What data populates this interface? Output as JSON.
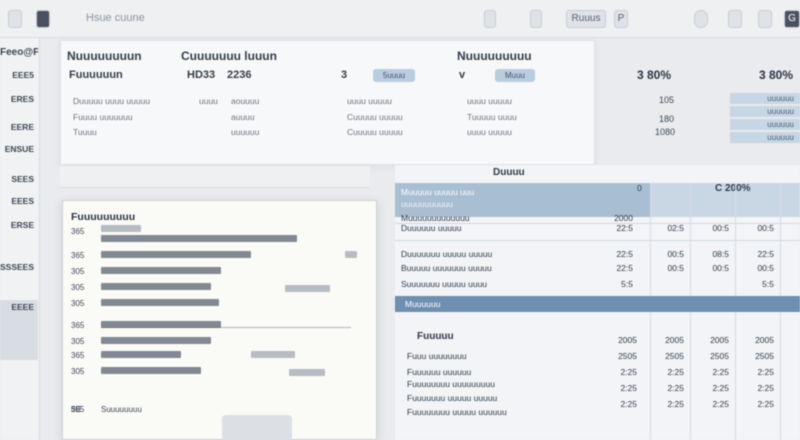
{
  "toolbar": {
    "search_placeholder": "Hsue cuune",
    "btn_a": "Ruuus",
    "btn_b": "P",
    "label_right": "G"
  },
  "sidebar": {
    "title": "Feeo@P",
    "items": [
      "EEE5",
      "ERES",
      "EERE",
      "ENSUE",
      "SEES",
      "EEES",
      "ERSE",
      "SSSEES",
      "EEEE"
    ]
  },
  "top_panel": {
    "col1_head": "Nuuuuuuuun",
    "col2_head": "Cuuuuuuu luuun",
    "col3_head": "Nuuuuuuuuu",
    "row_label": "Fuuuuuun",
    "row_val_a": "HD33",
    "row_val_b": "2236",
    "row_val_c": "3",
    "pill_a": "5uuuu",
    "pill_b": "Muuu",
    "sub_rows": [
      {
        "a": "Duuuuu uuuu uuuuu",
        "b": "uuuu",
        "c": "aouuuu",
        "d": "uuuu uuuuu",
        "e": "uuuu uuuuu"
      },
      {
        "a": "Fuuuu uuuuuuu",
        "b": "",
        "c": "auuuu",
        "d": "Cuuuuu uuuuu",
        "e": "Tuuuuu uuuu"
      },
      {
        "a": "Tuuuu",
        "b": "",
        "c": "uuuuuu",
        "d": "Cuuuuu uuuuu",
        "e": "uuuu uuuuu"
      }
    ]
  },
  "right_top": {
    "head_a": "3 80%",
    "head_b": "3 80%",
    "vals": [
      "105",
      "180",
      "1080"
    ],
    "cells": [
      "uuuuuu",
      "uuuuuu",
      "uuuuuu",
      "uuuuuu"
    ]
  },
  "document": {
    "title": "Fuuuuuuuuu",
    "numbers": [
      "365",
      "365",
      "305",
      "305",
      "305",
      "365",
      "305",
      "365",
      "305",
      "305"
    ],
    "footer_num": "5E",
    "footer_text": "Suuuuuuuu"
  },
  "grid": {
    "title": "Duuuu",
    "head_label": "Muuuuu uuuuu uuu",
    "head_sub": "uuuuuuuuuuu",
    "head_num": "0",
    "head_right": "C 200%",
    "rows_top": [
      {
        "label": "Muuuuuuuuuuuuu",
        "v": [
          "2000",
          "",
          "",
          ""
        ]
      },
      {
        "label": "Duuuuuu uuuuu",
        "v": [
          "22:5",
          "02:5",
          "00:5",
          "00:5"
        ]
      },
      {
        "label": "Duuuuuuu uuuuu uuuuu",
        "v": [
          "22:5",
          "00:5",
          "08:5",
          "22:5"
        ]
      },
      {
        "label": "Buuuuu uuuuuuu uuuuu",
        "v": [
          "22:5",
          "00:5",
          "00:5",
          "00:5"
        ]
      },
      {
        "label": "Suuuuuuu uuuuu uuuu",
        "v": [
          "5:5",
          "",
          "",
          "5:5"
        ]
      }
    ],
    "selected_label": "Muuuuuu",
    "section_title": "Fuuuuu",
    "rows_bottom": [
      {
        "label": "Fuuu uuuuuuuu",
        "v": [
          "2005",
          "2005",
          "2005",
          "2005"
        ]
      },
      {
        "label": "Fuuuuuu uuuuuu",
        "v": [
          "2505",
          "2505",
          "2505",
          "2505"
        ]
      },
      {
        "label": "Fuuuuuuuu uuuuuuuuu",
        "v": [
          "2:25",
          "2:25",
          "2:25",
          "2:25"
        ]
      },
      {
        "label": "Fuuuuuuu uuuuu uuuuu",
        "v": [
          "2:25",
          "2:25",
          "2:25",
          "2:25"
        ]
      },
      {
        "label": "Fuuuuuuuu uuuuu uuuuuu",
        "v": [
          "2:25",
          "2:25",
          "2:25",
          "2:25"
        ]
      }
    ]
  }
}
